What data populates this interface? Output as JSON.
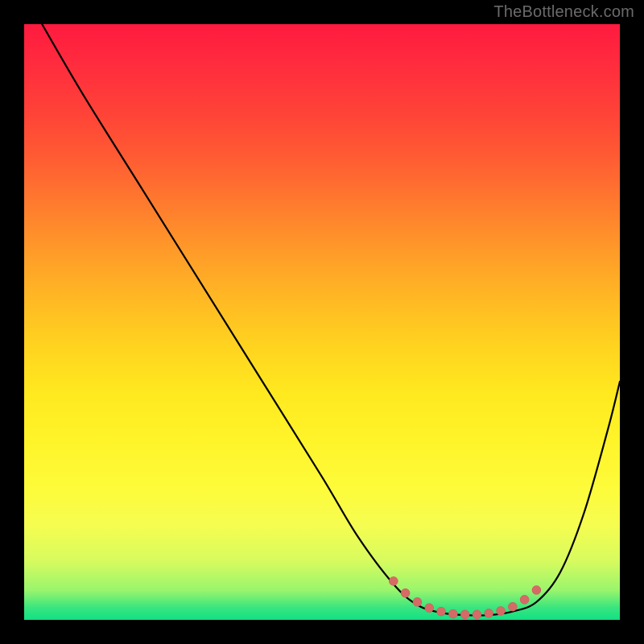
{
  "watermark": "TheBottleneck.com",
  "chart_data": {
    "type": "line",
    "title": "",
    "xlabel": "",
    "ylabel": "",
    "xlim": [
      0,
      100
    ],
    "ylim": [
      0,
      100
    ],
    "background_gradient": [
      "#ff1a3f",
      "#ff7a2e",
      "#ffd31f",
      "#fdfb3a",
      "#38e57f"
    ],
    "series": [
      {
        "name": "curve",
        "x": [
          3,
          10,
          20,
          30,
          40,
          50,
          56,
          62,
          66,
          70,
          74,
          78,
          82,
          86,
          90,
          94,
          98,
          100
        ],
        "y": [
          100,
          88,
          72,
          56,
          40,
          24,
          14,
          6,
          2.5,
          1.2,
          0.8,
          0.8,
          1.4,
          3,
          8,
          18,
          32,
          40
        ]
      }
    ],
    "sweet_spot_markers": {
      "name": "optimal-range",
      "color": "#d66a66",
      "points_x": [
        62,
        64,
        66,
        68,
        70,
        72,
        74,
        76,
        78,
        80,
        82,
        84,
        86
      ],
      "points_y": [
        6.5,
        4.5,
        3.0,
        2.0,
        1.4,
        1.0,
        0.9,
        0.9,
        1.1,
        1.5,
        2.2,
        3.4,
        5.0
      ]
    }
  }
}
